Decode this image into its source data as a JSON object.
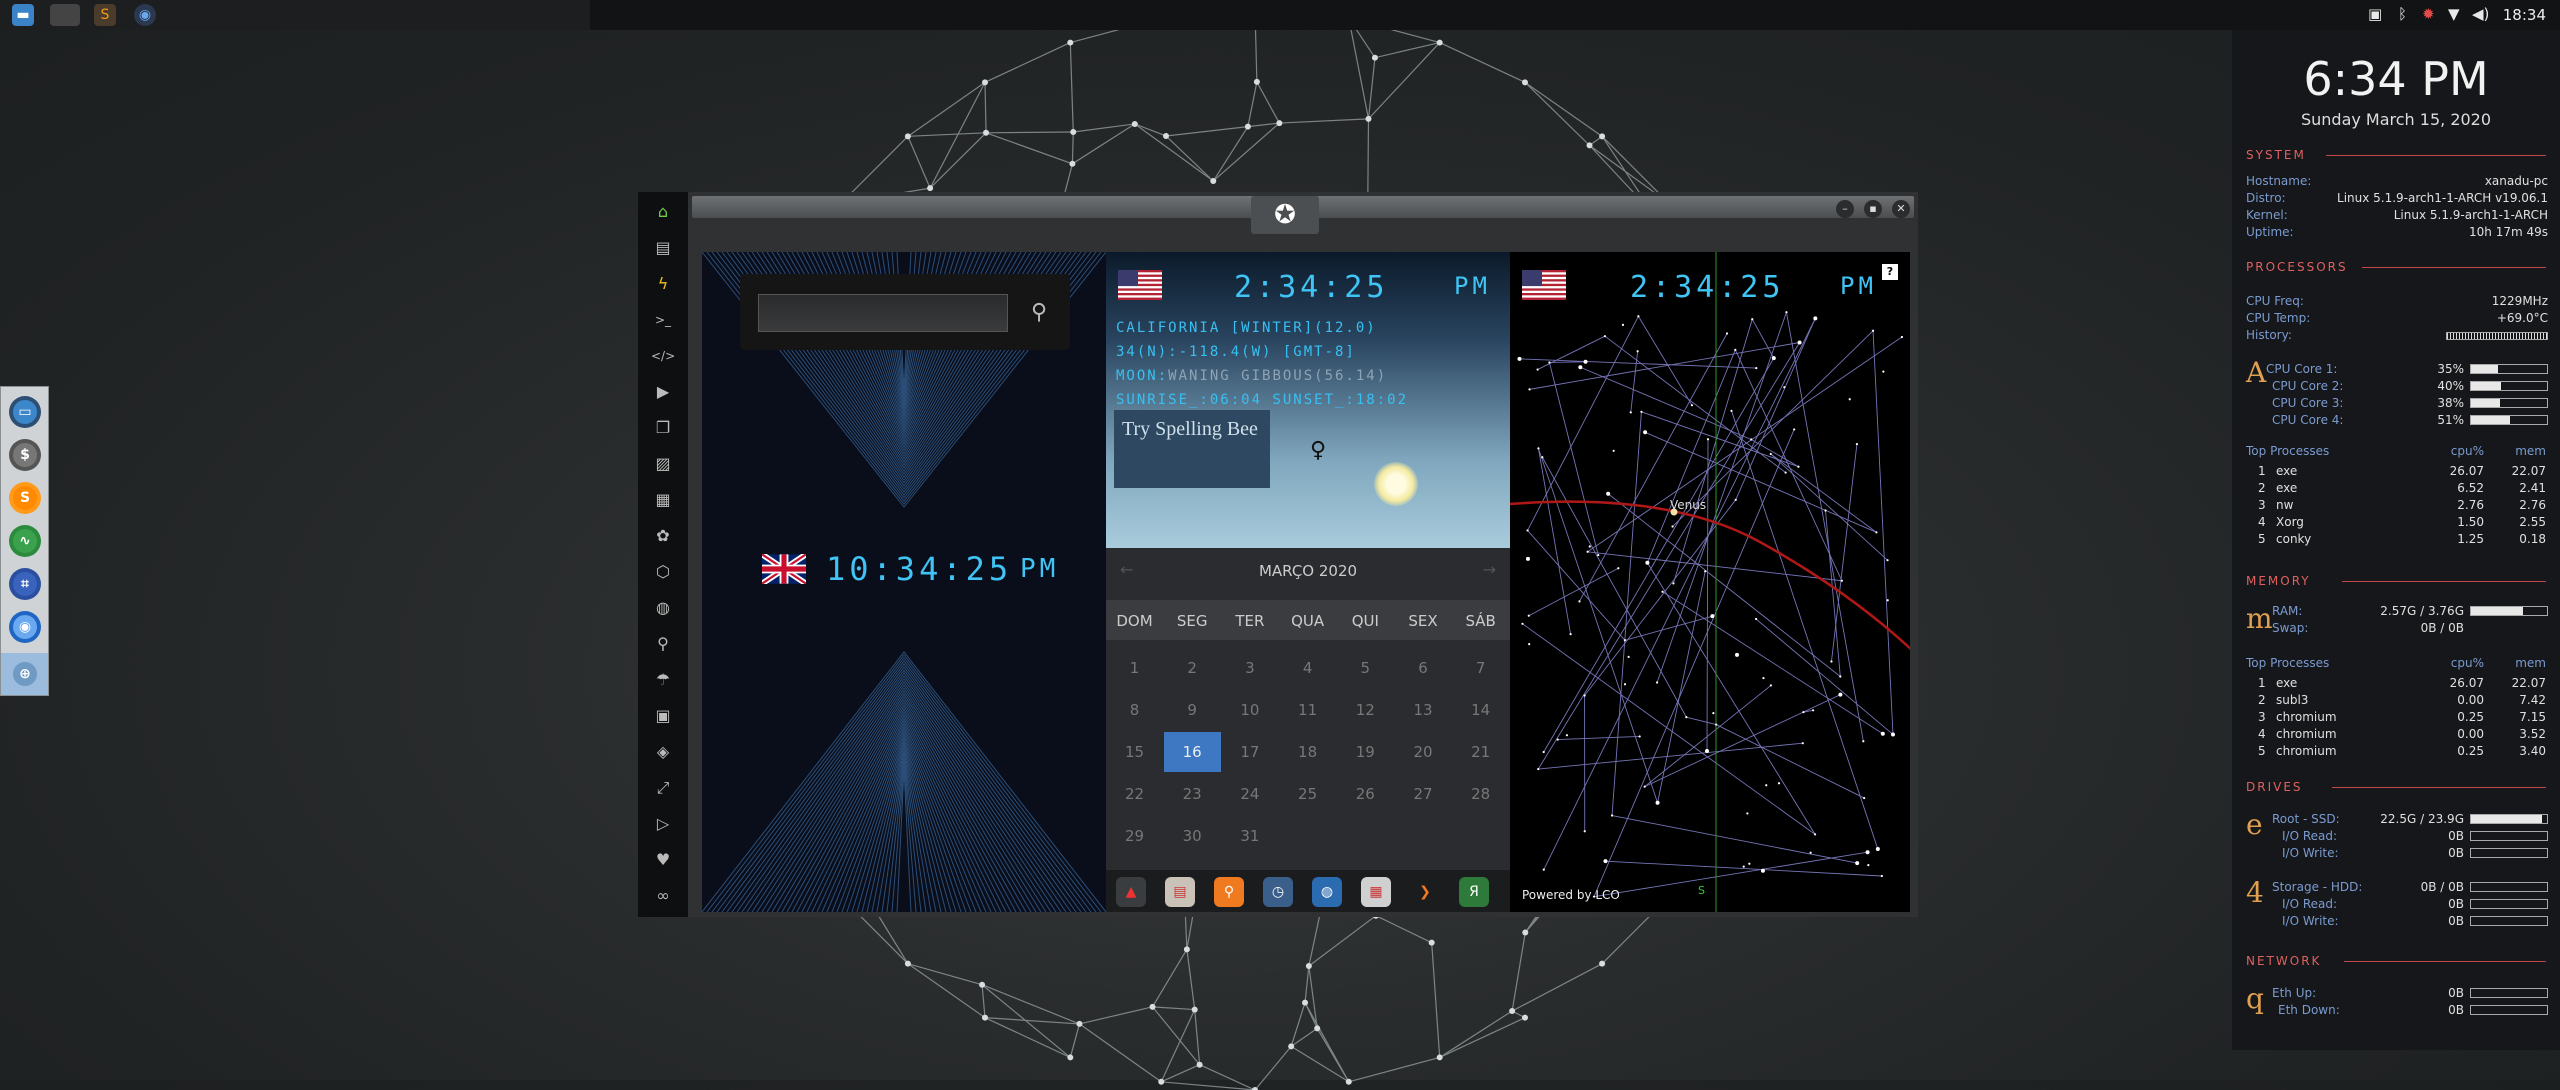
{
  "topbar": {
    "clock": "18:34",
    "tray_icons": [
      "screenshot-icon",
      "bluetooth-icon",
      "gear-icon",
      "wifi-icon",
      "volume-icon"
    ]
  },
  "taskbar": {
    "apps": [
      "files",
      "blank-app",
      "sublime-text",
      "chromium"
    ]
  },
  "dock": {
    "items": [
      "files",
      "money",
      "sublime-text",
      "system-monitor",
      "screen-capture",
      "chromium",
      "web-browser"
    ]
  },
  "sidebar": {
    "icons": [
      "home-icon",
      "document-icon",
      "bolt-icon",
      "terminal-icon",
      "code-icon",
      "play-icon",
      "pages-icon",
      "image-icon",
      "news-icon",
      "settings-icon",
      "hexagon-icon",
      "globe-icon",
      "search-icon",
      "umbrella-icon",
      "contact-icon",
      "tag-icon",
      "expand-icon",
      "youtube-icon",
      "heart-icon",
      "infinity-icon"
    ]
  },
  "window": {
    "emblem": "rebel-alliance-icon"
  },
  "uk_panel": {
    "time": "10:34:25",
    "ampm": "PM",
    "search_value": ""
  },
  "ca_panel": {
    "time": "2:34:25",
    "ampm": "PM",
    "line1": "CALIFORNIA [WINTER](12.0)",
    "line2": "34(N):-118.4(W) [GMT-8]",
    "moon_label": "MOON:",
    "moon_value": "WANING GIBBOUS(56.14)",
    "line4": "SUNRISE_:06:04 SUNSET_:18:02",
    "spelling_bee": "Try Spelling Bee",
    "venus_symbol": "♀"
  },
  "calendar": {
    "month": "MARÇO 2020",
    "prev": "←",
    "next": "→",
    "weekdays": [
      "DOM",
      "SEG",
      "TER",
      "QUA",
      "QUI",
      "SEX",
      "SÁB"
    ],
    "weeks": [
      [
        "1",
        "2",
        "3",
        "4",
        "5",
        "6",
        "7"
      ],
      [
        "8",
        "9",
        "10",
        "11",
        "12",
        "13",
        "14"
      ],
      [
        "15",
        "16",
        "17",
        "18",
        "19",
        "20",
        "21"
      ],
      [
        "22",
        "23",
        "24",
        "25",
        "26",
        "27",
        "28"
      ],
      [
        "29",
        "30",
        "31",
        "",
        "",
        "",
        ""
      ]
    ],
    "selected": "16"
  },
  "launcher": {
    "icons": [
      "arch-icon",
      "calendar-app-icon",
      "search-app-icon",
      "clock-icon",
      "globe-icon",
      "schedule-icon",
      "arrow-icon",
      "yandex-icon"
    ]
  },
  "star_panel": {
    "time": "2:34:25",
    "ampm": "PM",
    "venus_label": "Venus",
    "powered_by": "Powered by LCO",
    "south_marker": "S",
    "help": "?"
  },
  "conky": {
    "time": "6:34 PM",
    "date": "Sunday March 15, 2020",
    "system": {
      "title": "SYSTEM",
      "rows": [
        {
          "label": "Hostname:",
          "value": "xanadu-pc"
        },
        {
          "label": "Distro:",
          "value": "Linux 5.1.9-arch1-1-ARCH v19.06.1"
        },
        {
          "label": "Kernel:",
          "value": "Linux 5.1.9-arch1-1-ARCH"
        },
        {
          "label": "Uptime:",
          "value": "10h 17m 49s"
        }
      ]
    },
    "processors": {
      "title": "PROCESSORS",
      "freq_label": "CPU Freq:",
      "freq": "1229MHz",
      "temp_label": "CPU Temp:",
      "temp": "+69.0°C",
      "history_label": "History:",
      "glyph": "A",
      "cores": [
        {
          "label": "CPU Core 1:",
          "value": "35%",
          "pct": 35
        },
        {
          "label": "CPU Core 2:",
          "value": "40%",
          "pct": 40
        },
        {
          "label": "CPU Core 3:",
          "value": "38%",
          "pct": 38
        },
        {
          "label": "CPU Core 4:",
          "value": "51%",
          "pct": 51
        }
      ],
      "top_title": "Top Processes",
      "col_cpu": "cpu%",
      "col_mem": "mem",
      "top": [
        {
          "n": "1",
          "name": "exe",
          "cpu": "26.07",
          "mem": "22.07"
        },
        {
          "n": "2",
          "name": "exe",
          "cpu": "6.52",
          "mem": "2.41"
        },
        {
          "n": "3",
          "name": "nw",
          "cpu": "2.76",
          "mem": "2.76"
        },
        {
          "n": "4",
          "name": "Xorg",
          "cpu": "1.50",
          "mem": "2.55"
        },
        {
          "n": "5",
          "name": "conky",
          "cpu": "1.25",
          "mem": "0.18"
        }
      ]
    },
    "memory": {
      "title": "MEMORY",
      "glyph": "m",
      "ram_label": "RAM:",
      "ram": "2.57G / 3.76G",
      "ram_pct": 68,
      "swap_label": "Swap:",
      "swap": "0B / 0B",
      "top_title": "Top Processes",
      "col_cpu": "cpu%",
      "col_mem": "mem",
      "top": [
        {
          "n": "1",
          "name": "exe",
          "cpu": "26.07",
          "mem": "22.07"
        },
        {
          "n": "2",
          "name": "subl3",
          "cpu": "0.00",
          "mem": "7.42"
        },
        {
          "n": "3",
          "name": "chromium",
          "cpu": "0.25",
          "mem": "7.15"
        },
        {
          "n": "4",
          "name": "chromium",
          "cpu": "0.00",
          "mem": "3.52"
        },
        {
          "n": "5",
          "name": "chromium",
          "cpu": "0.25",
          "mem": "3.40"
        }
      ]
    },
    "drives": {
      "title": "DRIVES",
      "glyph1": "e",
      "root_label": "Root  -  SSD:",
      "root": "22.5G / 23.9G",
      "root_pct": 94,
      "read_label": "I/O Read:",
      "read": "0B",
      "write_label": "I/O Write:",
      "write": "0B",
      "glyph2": "4",
      "storage_label": "Storage  -  HDD:",
      "storage": "0B / 0B",
      "read2": "0B",
      "write2": "0B"
    },
    "network": {
      "title": "NETWORK",
      "glyph": "q",
      "up_label": "Eth Up:",
      "up": "0B",
      "down_label": "Eth Down:",
      "down": "0B"
    }
  }
}
